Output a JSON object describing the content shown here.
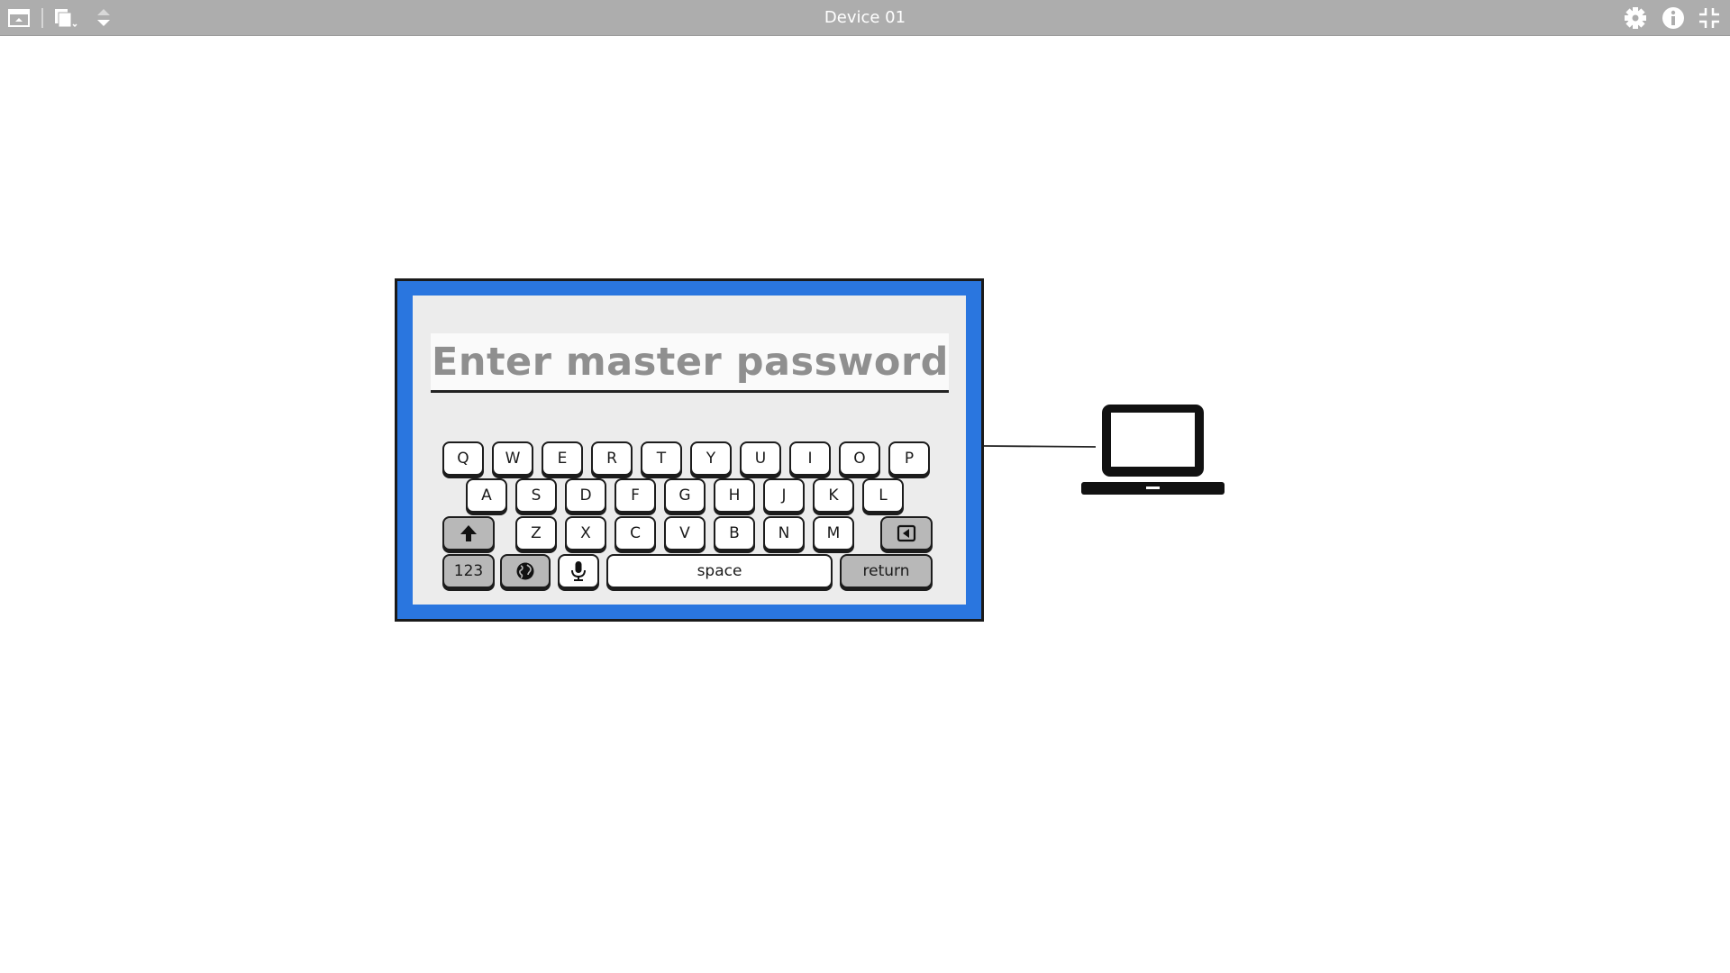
{
  "window": {
    "title": "Device 01"
  },
  "toolbar": {
    "left_icons": [
      "window-icon",
      "copy-icon",
      "up-down-arrows-icon"
    ],
    "right_icons": [
      "gear-icon",
      "info-icon",
      "collapse-icon"
    ]
  },
  "device": {
    "frame_color": "#2a76df",
    "password_placeholder": "Enter master password",
    "keyboard": {
      "row1": [
        "Q",
        "W",
        "E",
        "R",
        "T",
        "Y",
        "U",
        "I",
        "O",
        "P"
      ],
      "row2": [
        "A",
        "S",
        "D",
        "F",
        "G",
        "H",
        "J",
        "K",
        "L"
      ],
      "row3": [
        "Z",
        "X",
        "C",
        "V",
        "B",
        "N",
        "M"
      ],
      "shift_icon": "shift-arrow-icon",
      "backspace_icon": "backspace-icon",
      "numbers_label": "123",
      "globe_icon": "globe-icon",
      "mic_icon": "microphone-icon",
      "space_label": "space",
      "return_label": "return"
    }
  },
  "connected_device": {
    "icon": "laptop-icon"
  }
}
